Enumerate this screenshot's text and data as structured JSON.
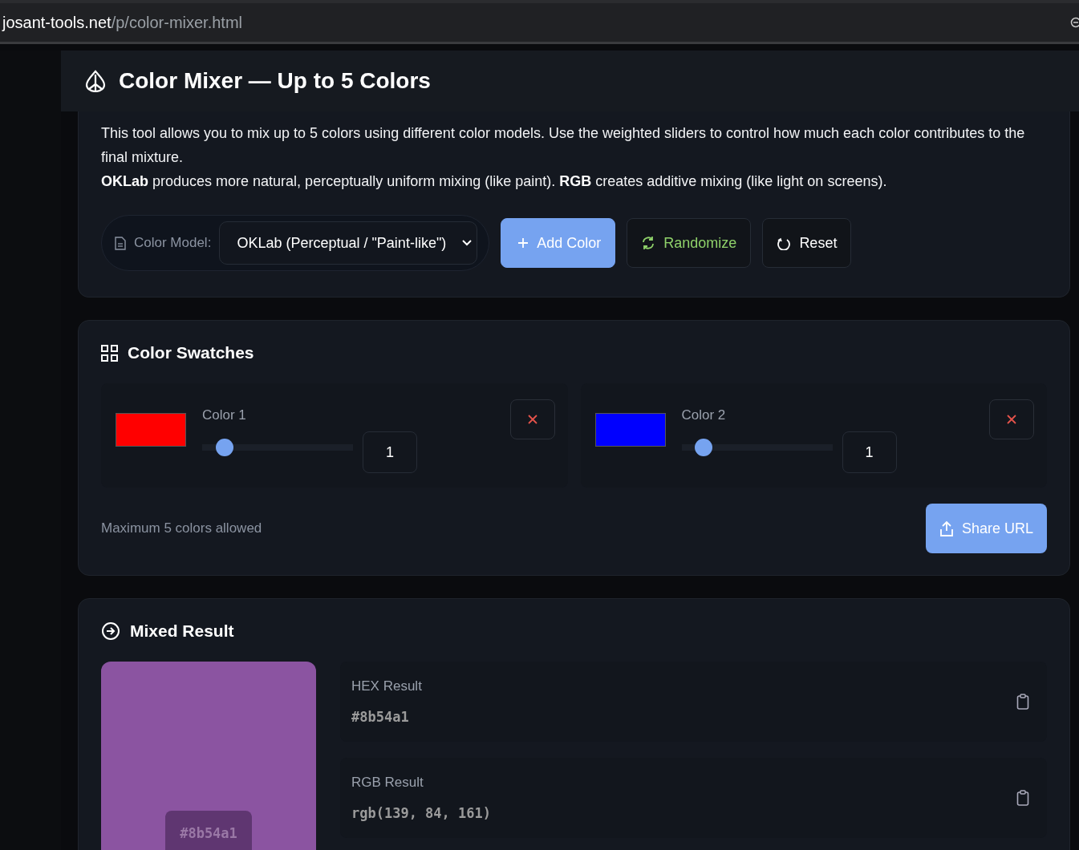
{
  "browser": {
    "url_host": "josant-tools.net",
    "url_path": "/p/color-mixer.html"
  },
  "header": {
    "title": "Color Mixer — Up to 5 Colors"
  },
  "intro": {
    "paragraphs": [
      "This tool allows you to mix up to 5 colors using different color models. Use the weighted sliders to control how much each color contributes to the final mixture.",
      "**OKLab** produces more natural, perceptually uniform mixing (like paint). **RGB** creates additive mixing (like light on screens)."
    ]
  },
  "controls": {
    "model_label": "Color Model:",
    "model_value": "OKLab (Perceptual / \"Paint-like\")",
    "buttons": [
      {
        "kind": "add",
        "label": "Add Color"
      },
      {
        "kind": "randomize",
        "label": "Randomize"
      },
      {
        "kind": "reset",
        "label": "Reset"
      }
    ]
  },
  "swatches": {
    "title": "Color Swatches",
    "items": [
      {
        "label": "Color 1",
        "color": "#ff0000",
        "level": 0.1,
        "weight": "1"
      },
      {
        "label": "Color 2",
        "color": "#0000ff",
        "level": 0.1,
        "weight": "1"
      }
    ],
    "note": "Maximum 5 colors allowed",
    "share_button": "Share URL"
  },
  "result": {
    "title": "Mixed Result",
    "color": "#8b54a1",
    "preview_label": "#8b54a1",
    "fields": [
      {
        "label": "HEX Result",
        "value": "#8b54a1"
      },
      {
        "label": "RGB Result",
        "value": "rgb(139, 84, 161)"
      }
    ]
  }
}
